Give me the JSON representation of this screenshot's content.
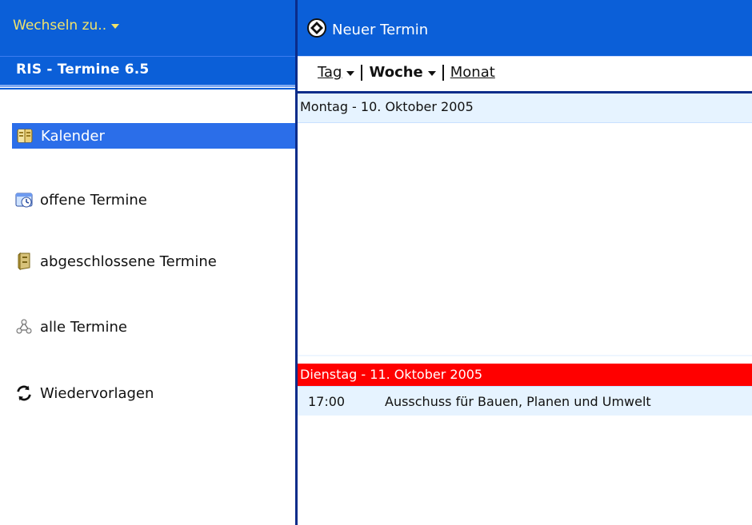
{
  "left": {
    "switch_label": "Wechseln zu..",
    "app_title": "RIS - Termine 6.5",
    "nav": [
      {
        "label": "Kalender",
        "icon": "calendar-book-icon",
        "selected": true
      },
      {
        "label": "offene Termine",
        "icon": "clock-calendar-icon",
        "selected": false
      },
      {
        "label": "abgeschlossene Termine",
        "icon": "filing-cabinet-icon",
        "selected": false
      },
      {
        "label": "alle Termine",
        "icon": "network-nodes-icon",
        "selected": false
      },
      {
        "label": "Wiedervorlagen",
        "icon": "refresh-icon",
        "selected": false
      }
    ]
  },
  "right": {
    "new_appointment_label": "Neuer Termin",
    "view_tabs": [
      {
        "label": "Tag",
        "has_caret": true,
        "bold": false
      },
      {
        "label": "Woche",
        "has_caret": true,
        "bold": true
      },
      {
        "label": "Monat",
        "has_caret": false,
        "bold": false
      }
    ],
    "days": [
      {
        "label": "Montag - 10. Oktober 2005",
        "style": "light"
      },
      {
        "label": "Dienstag - 11. Oktober 2005",
        "style": "highlight"
      }
    ],
    "events": [
      {
        "time": "17:00",
        "title": "Ausschuss für Bauen, Planen und Umwelt"
      }
    ]
  },
  "colors": {
    "header_blue": "#0b5fd8",
    "switch_text": "#f1e36a",
    "selected_nav_bg": "#2b6ee9",
    "day_light_bg": "#e6f3ff",
    "day_highlight_bg": "#ff0000",
    "divider": "#0b2c8a"
  }
}
